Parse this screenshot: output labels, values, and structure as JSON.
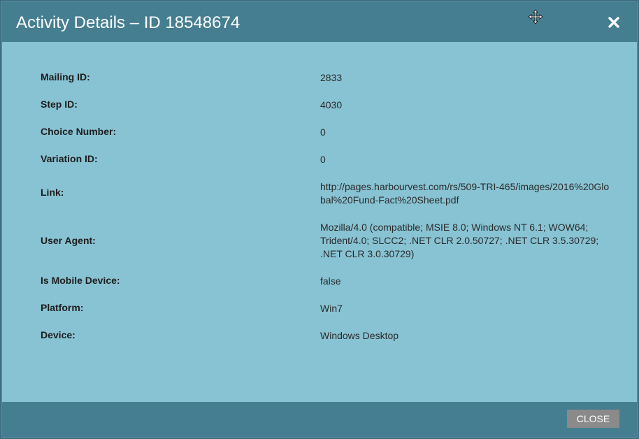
{
  "dialog": {
    "title": "Activity Details – ID 18548674",
    "close_label": "CLOSE"
  },
  "fields": [
    {
      "label": "Mailing ID:",
      "value": "2833"
    },
    {
      "label": "Step ID:",
      "value": "4030"
    },
    {
      "label": "Choice Number:",
      "value": "0"
    },
    {
      "label": "Variation ID:",
      "value": "0"
    },
    {
      "label": "Link:",
      "value": "http://pages.harbourvest.com/rs/509-TRI-465/images/2016%20Global%20Fund-Fact%20Sheet.pdf"
    },
    {
      "label": "User Agent:",
      "value": "Mozilla/4.0 (compatible; MSIE 8.0; Windows NT 6.1; WOW64; Trident/4.0; SLCC2; .NET CLR 2.0.50727; .NET CLR 3.5.30729; .NET CLR 3.0.30729)"
    },
    {
      "label": "Is Mobile Device:",
      "value": "false"
    },
    {
      "label": "Platform:",
      "value": "Win7"
    },
    {
      "label": "Device:",
      "value": "Windows Desktop"
    }
  ],
  "icons": {
    "move": "move-icon",
    "close": "close-icon"
  },
  "colors": {
    "header": "#457e90",
    "body": "#88c3d3",
    "button": "#8a8a8a"
  }
}
